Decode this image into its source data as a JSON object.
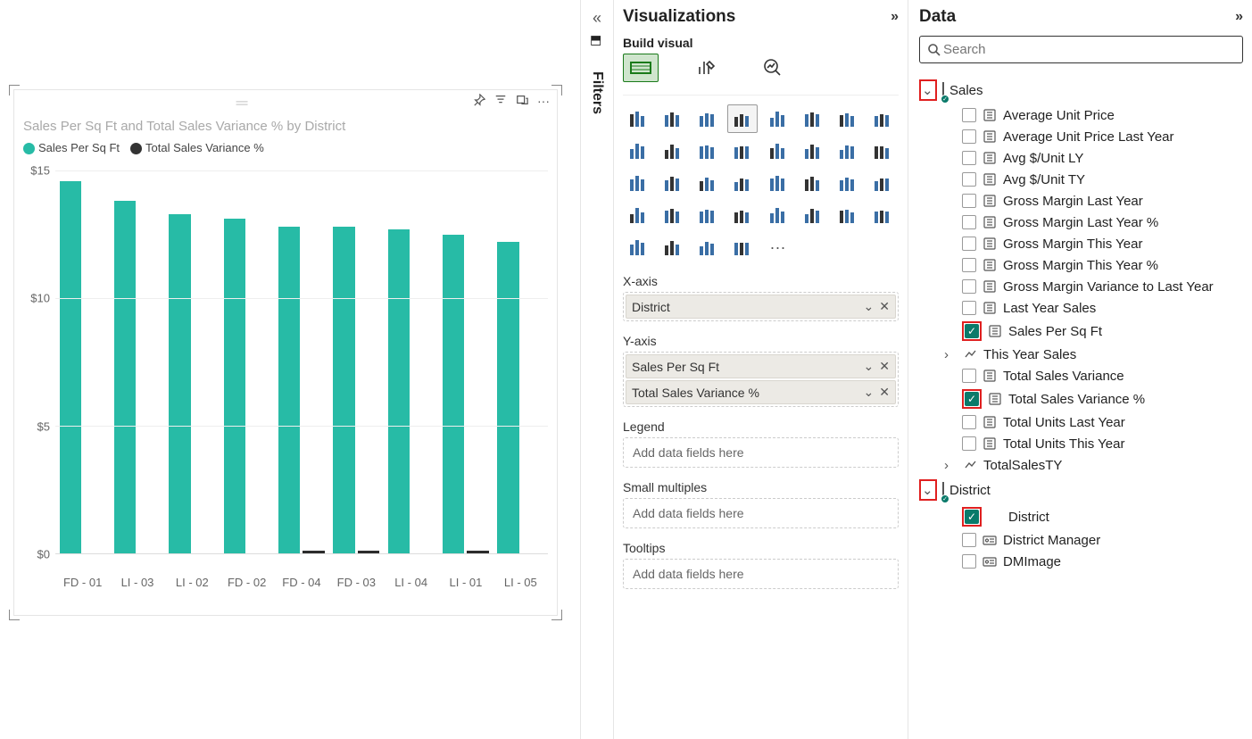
{
  "chart_data": {
    "type": "bar",
    "title": "Sales Per Sq Ft and Total Sales Variance % by District",
    "xlabel": "",
    "ylabel": "",
    "ylim": [
      0,
      15
    ],
    "x_field": "District",
    "categories": [
      "FD - 01",
      "LI - 03",
      "LI - 02",
      "FD - 02",
      "FD - 04",
      "FD - 03",
      "LI - 04",
      "LI - 01",
      "LI - 05"
    ],
    "series": [
      {
        "name": "Sales Per Sq Ft",
        "color": "#27bba6",
        "values": [
          14.6,
          13.8,
          13.3,
          13.1,
          12.8,
          12.8,
          12.7,
          12.5,
          12.2
        ]
      },
      {
        "name": "Total Sales Variance %",
        "color": "#333333",
        "values": [
          0,
          0,
          0,
          0,
          0.1,
          0.1,
          0,
          0.1,
          0
        ]
      }
    ],
    "y_ticks": [
      "$15",
      "$10",
      "$5",
      "$0"
    ],
    "y_tick_values": [
      15,
      10,
      5,
      0
    ]
  },
  "collapse_filters": {
    "label": "Filters"
  },
  "viz_pane": {
    "title": "Visualizations",
    "subtitle": "Build visual",
    "expand_glyph": "»",
    "wells": {
      "xaxis": {
        "label": "X-axis",
        "chips": [
          "District"
        ]
      },
      "yaxis": {
        "label": "Y-axis",
        "chips": [
          "Sales Per Sq Ft",
          "Total Sales Variance %"
        ]
      },
      "legend": {
        "label": "Legend",
        "placeholder": "Add data fields here"
      },
      "smallmult": {
        "label": "Small multiples",
        "placeholder": "Add data fields here"
      },
      "tooltips": {
        "label": "Tooltips",
        "placeholder": "Add data fields here"
      }
    }
  },
  "data_pane": {
    "title": "Data",
    "expand_glyph": "»",
    "search_placeholder": "Search",
    "tables": [
      {
        "name": "Sales",
        "highlight_arrow": true,
        "fields": [
          {
            "name": "Average Unit Price",
            "icon": "measure",
            "checked": false
          },
          {
            "name": "Average Unit Price Last Year",
            "icon": "measure",
            "checked": false
          },
          {
            "name": "Avg $/Unit LY",
            "icon": "measure",
            "checked": false
          },
          {
            "name": "Avg $/Unit TY",
            "icon": "measure",
            "checked": false
          },
          {
            "name": "Gross Margin Last Year",
            "icon": "measure",
            "checked": false
          },
          {
            "name": "Gross Margin Last Year %",
            "icon": "measure",
            "checked": false
          },
          {
            "name": "Gross Margin This Year",
            "icon": "measure",
            "checked": false
          },
          {
            "name": "Gross Margin This Year %",
            "icon": "measure",
            "checked": false
          },
          {
            "name": "Gross Margin Variance to Last Year",
            "icon": "measure",
            "checked": false
          },
          {
            "name": "Last Year Sales",
            "icon": "measure",
            "checked": false
          },
          {
            "name": "Sales Per Sq Ft",
            "icon": "measure",
            "checked": true,
            "highlight": true
          },
          {
            "name": "This Year Sales",
            "icon": "hierarchy",
            "checked": null,
            "expandable": true
          },
          {
            "name": "Total Sales Variance",
            "icon": "measure",
            "checked": false
          },
          {
            "name": "Total Sales Variance %",
            "icon": "measure",
            "checked": true,
            "highlight": true
          },
          {
            "name": "Total Units Last Year",
            "icon": "measure",
            "checked": false
          },
          {
            "name": "Total Units This Year",
            "icon": "measure",
            "checked": false
          },
          {
            "name": "TotalSalesTY",
            "icon": "hierarchy",
            "checked": null,
            "expandable": true
          }
        ]
      },
      {
        "name": "District",
        "highlight_arrow": true,
        "fields": [
          {
            "name": "District",
            "icon": "none",
            "checked": true,
            "highlight": true
          },
          {
            "name": "District Manager",
            "icon": "card",
            "checked": false
          },
          {
            "name": "DMImage",
            "icon": "card",
            "checked": false
          }
        ]
      }
    ]
  }
}
